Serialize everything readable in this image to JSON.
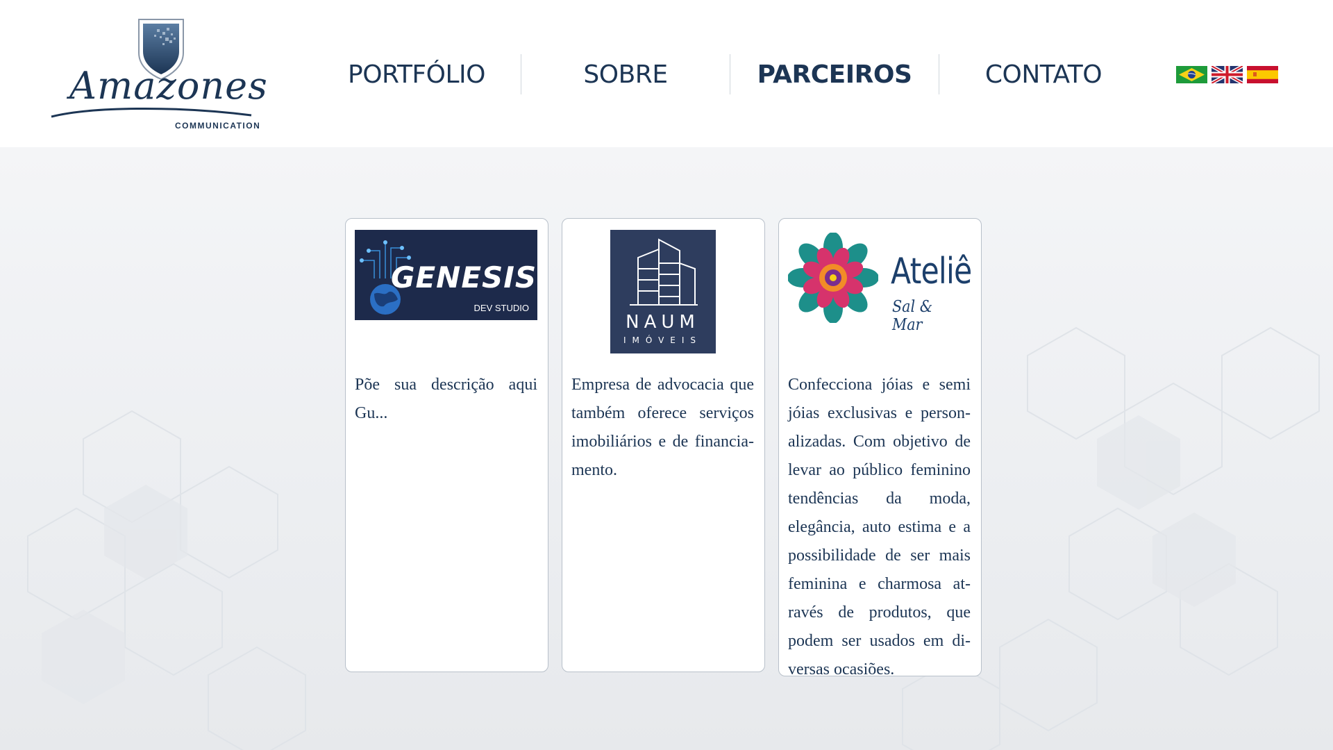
{
  "brand": {
    "name": "Amazones",
    "tagline": "COMMUNICATION"
  },
  "nav": {
    "items": [
      {
        "label": "PORTFÓLIO",
        "active": false
      },
      {
        "label": "SOBRE",
        "active": false
      },
      {
        "label": "PARCEIROS",
        "active": true
      },
      {
        "label": "CONTATO",
        "active": false
      }
    ]
  },
  "languages": [
    {
      "icon": "brazil-flag-icon"
    },
    {
      "icon": "uk-flag-icon"
    },
    {
      "icon": "spain-flag-icon"
    }
  ],
  "partners": [
    {
      "logo": {
        "name": "GENESIS",
        "sub": "DEV STUDIO"
      },
      "description": "Põe sua descrição aqui Gu..."
    },
    {
      "logo": {
        "name": "NAUM",
        "sub": "IMÓVEIS"
      },
      "description": "Empresa de advocacia que também oferece serviços imobiliários e de financia­mento."
    },
    {
      "logo": {
        "name": "Ateliê",
        "sub": "Sal & Mar"
      },
      "description": "Confecciona jóias e semi jóias exclusivas e person­alizadas. Com objetivo de levar ao público feminino tendências da moda, elegância, auto estima e a possibilidade de ser mais feminina e charmosa at­ravés de produtos, que podem ser usados em di­versas ocasiões."
    }
  ],
  "colors": {
    "primary": "#1c3554",
    "card_border": "#b8c0ca",
    "background": "#f3f4f6"
  }
}
